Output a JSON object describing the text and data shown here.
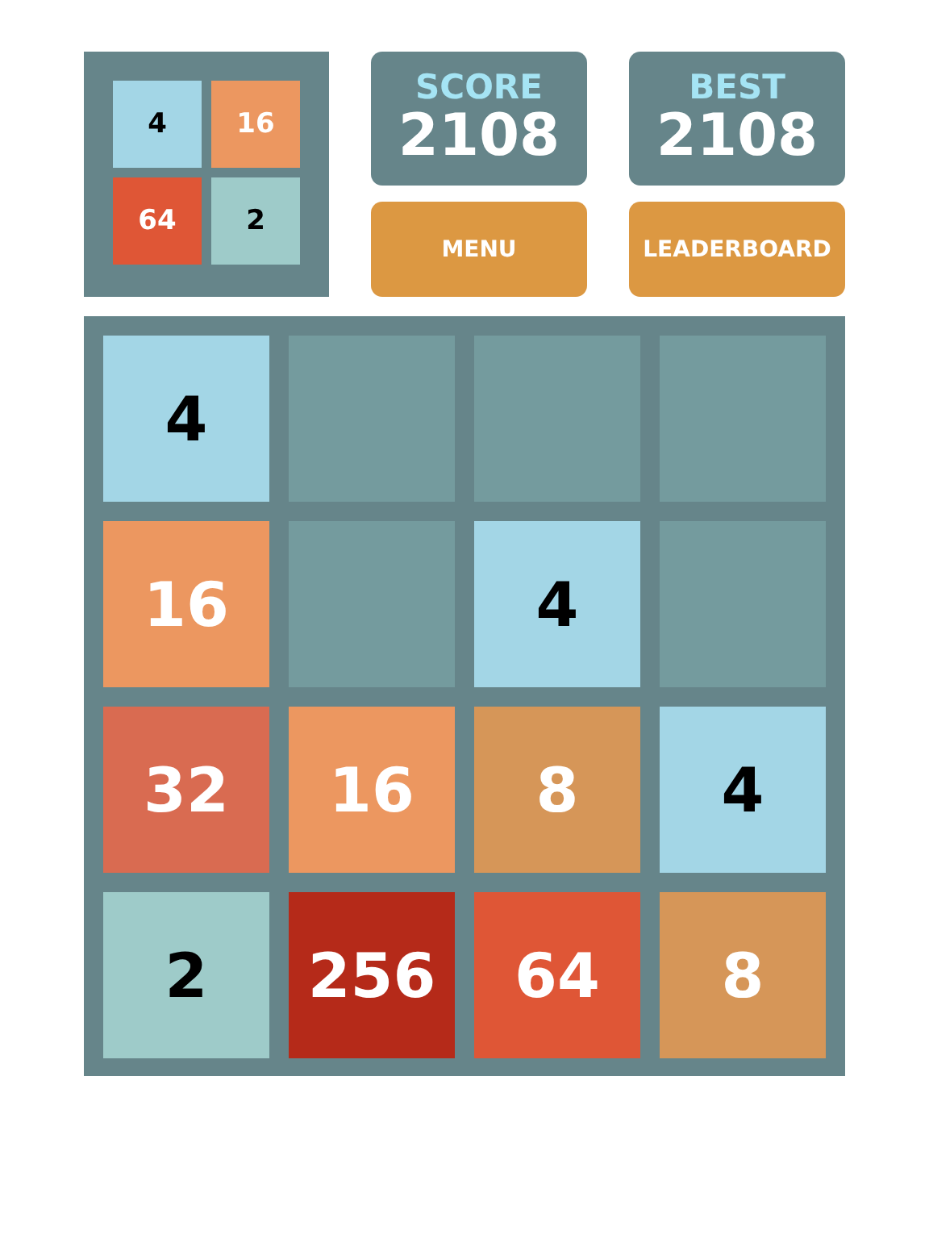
{
  "logo": {
    "tiles": [
      {
        "value": "4",
        "color": "#a3d6e6",
        "kind": "dark"
      },
      {
        "value": "16",
        "color": "#ec9760",
        "kind": "light"
      },
      {
        "value": "64",
        "color": "#df5636",
        "kind": "light"
      },
      {
        "value": "2",
        "color": "#9ecbc9",
        "kind": "dark"
      }
    ]
  },
  "score": {
    "label": "SCORE",
    "value": "2108"
  },
  "best": {
    "label": "BEST",
    "value": "2108"
  },
  "buttons": [
    "MENU",
    "LEADERBOARD"
  ],
  "board": {
    "tiles": [
      {
        "value": "4",
        "color": "#a3d6e6",
        "kind": "dark"
      },
      {
        "color": "#749b9e",
        "kind": "empty"
      },
      {
        "color": "#749b9e",
        "kind": "empty"
      },
      {
        "color": "#749b9e",
        "kind": "empty"
      },
      {
        "value": "16",
        "color": "#ec9760",
        "kind": "light"
      },
      {
        "color": "#749b9e",
        "kind": "empty"
      },
      {
        "value": "4",
        "color": "#a3d6e6",
        "kind": "dark"
      },
      {
        "color": "#749b9e",
        "kind": "empty"
      },
      {
        "value": "32",
        "color": "#d96b51",
        "kind": "light"
      },
      {
        "value": "16",
        "color": "#ec9760",
        "kind": "light"
      },
      {
        "value": "8",
        "color": "#d69658",
        "kind": "light"
      },
      {
        "value": "4",
        "color": "#a3d6e6",
        "kind": "dark"
      },
      {
        "value": "2",
        "color": "#9ecbc9",
        "kind": "dark"
      },
      {
        "value": "256",
        "color": "#b52a19",
        "kind": "light"
      },
      {
        "value": "64",
        "color": "#df5636",
        "kind": "light"
      },
      {
        "value": "8",
        "color": "#d69658",
        "kind": "light"
      }
    ]
  }
}
